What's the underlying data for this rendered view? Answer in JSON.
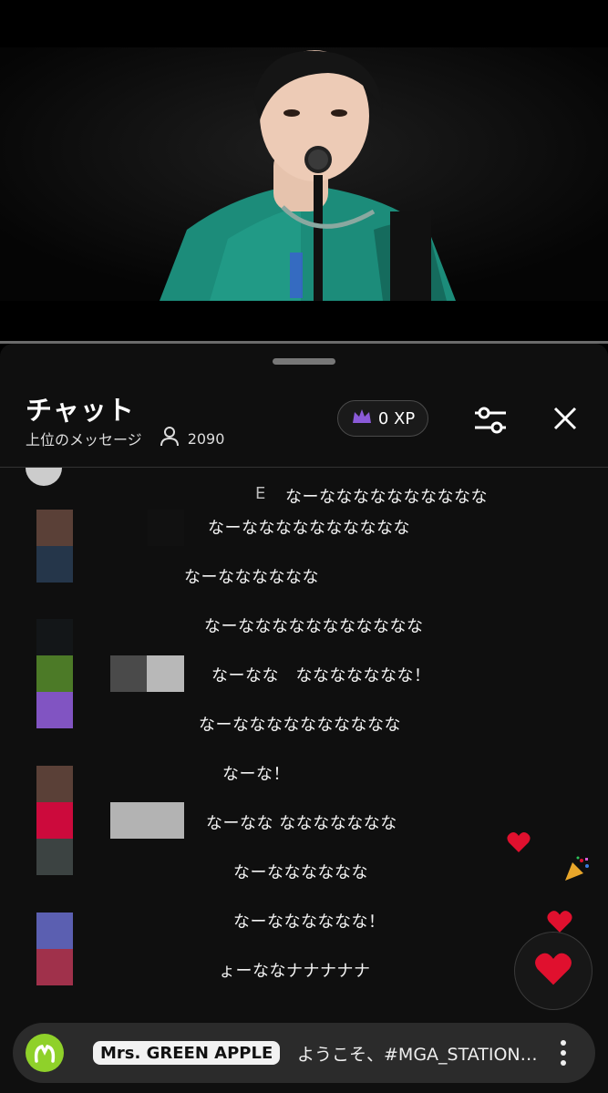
{
  "chat": {
    "title": "チャット",
    "mode_label": "上位のメッセージ",
    "viewer_count": "2090",
    "xp_label": "0 XP"
  },
  "messages": [
    {
      "prefix": "E",
      "text": "なーなななななななななな"
    },
    {
      "prefix": "",
      "text": "なーなななななななななな"
    },
    {
      "prefix": "",
      "text": "なーなななななな"
    },
    {
      "prefix": "",
      "text": "なーななななななななななな"
    },
    {
      "prefix": "",
      "text": "なーなな　ななななななな！"
    },
    {
      "prefix": "",
      "text": "なーなななななななななな"
    },
    {
      "prefix": "",
      "text": "なーな！"
    },
    {
      "prefix": "",
      "text": "なーなな ななななななな"
    },
    {
      "prefix": "",
      "text": "なーなななななな"
    },
    {
      "prefix": "",
      "text": "なーなななななな！"
    },
    {
      "prefix": "",
      "text": "ょーななナナナナナ"
    }
  ],
  "avatar_colors": [
    "#5a4037",
    "#25364a",
    "#131618",
    "#4c7a27",
    "#8154c2",
    "#5a4037",
    "#cc0a3c",
    "#3c4342",
    "#5b5fb1",
    "#a0314b"
  ],
  "footer": {
    "artist": "Mrs. GREEN APPLE",
    "welcome": "ようこそ、#MGA_STATION…"
  },
  "colors": {
    "accent_purple": "#8a5ad8",
    "heart_red": "#e0102e",
    "logo_green": "#8fd12a"
  },
  "icons": {
    "viewer": "person-icon",
    "crown": "crown-icon",
    "filter": "sliders-icon",
    "close": "close-icon",
    "heart": "heart-icon",
    "more": "more-vert-icon",
    "party": "party-popper-icon"
  }
}
